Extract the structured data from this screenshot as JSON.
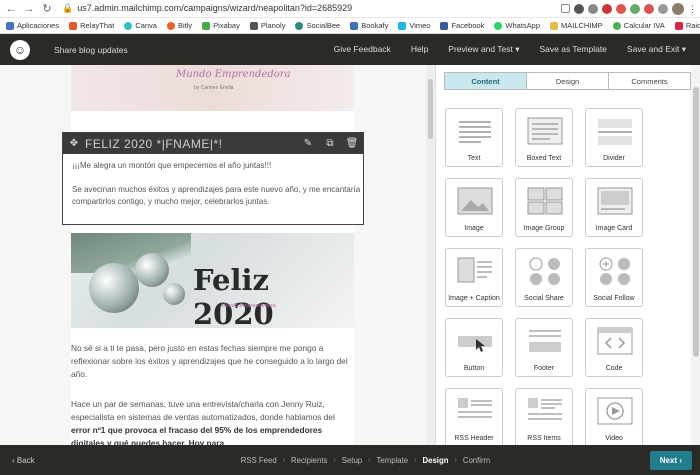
{
  "browser": {
    "url": "us7.admin.mailchimp.com/campaigns/wizard/neapolitan?id=2685929",
    "bookmarks": [
      "Aplicaciones",
      "RelayThat",
      "Canva",
      "Bitly",
      "Pixabay",
      "Planoly",
      "SocialBee",
      "Bookafy",
      "Vimeo",
      "Facebook",
      "WhatsApp",
      "MAILCHIMP",
      "Calcular IVA",
      "Raiola Networks -..."
    ]
  },
  "header": {
    "title": "Share blog updates",
    "actions": [
      "Give Feedback",
      "Help",
      "Preview and Test ▾",
      "Save as Template",
      "Save and Exit ▾"
    ]
  },
  "email": {
    "top_brand": "Mundo Emprendedora",
    "top_brand_sub": "by Carmen Emilia",
    "selected_block": {
      "heading": "FELIZ 2020 *|FNAME|*!",
      "paragraph1": "¡¡¡Me alegra un montón que empecemos el año juntas!!!",
      "paragraph2": "Se avecinan muchos éxitos y aprendizajes para este nuevo año, y me encantaría compartirlos contigo, y mucho mejor, celebrarlos juntas."
    },
    "hero": {
      "title": "Feliz 2020",
      "brand": "Mundo Emprendedora"
    },
    "para3": "No sé si a ti te pasa, pero justo en estas fechas siempre me pongo a reflexionar sobre los éxitos y aprendizajes que he conseguido a lo largo del año.",
    "para4_start": "Hace un par de semanas, tuve una entrevista/charla con Jenny Ruiz, especialista en sistemas de ventas automatizados, donde hablamos del ",
    "para4_bold": "error nº1 que provoca el fracaso del 95% de los emprendedores digitales y qué puedes hacer. Hoy para"
  },
  "panel": {
    "tabs": [
      "Content",
      "Design",
      "Comments"
    ],
    "active_tab": "Content",
    "blocks": [
      "Text",
      "Boxed Text",
      "Divider",
      "Image",
      "Image Group",
      "Image Card",
      "Image + Caption",
      "Social Share",
      "Social Follow",
      "Button",
      "Footer",
      "Code",
      "RSS Header",
      "RSS Items",
      "Video"
    ]
  },
  "footer": {
    "back": "Back",
    "steps": [
      "RSS Feed",
      "Recipients",
      "Setup",
      "Template",
      "Design",
      "Confirm"
    ],
    "current_step": "Design",
    "next": "Next"
  }
}
